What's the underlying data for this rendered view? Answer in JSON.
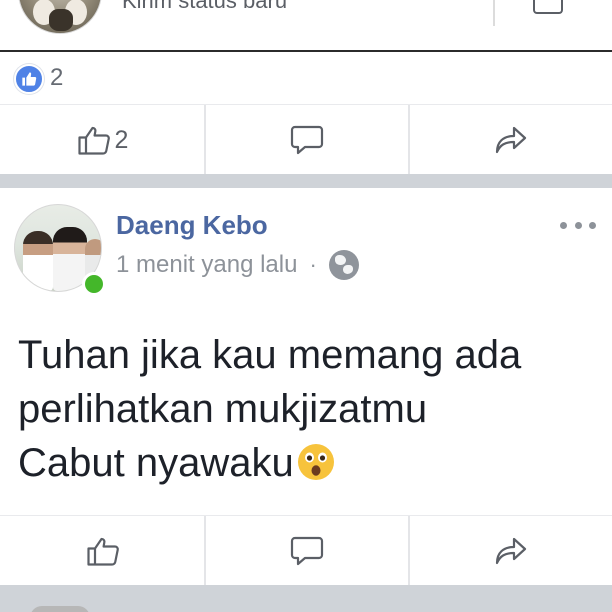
{
  "top_composer": {
    "status_prompt": "Kirim status baru"
  },
  "previous_post": {
    "reaction_count": "2",
    "like_count": "2"
  },
  "post": {
    "author": "Daeng Kebo",
    "time": "1 menit yang lalu",
    "separator": "·",
    "privacy_icon": "globe-icon",
    "online": true,
    "text_lines": [
      "Tuhan jika kau memang ada",
      "perlihatkan mukjizatmu",
      "Cabut nyawaku"
    ],
    "emoji": "astonished-face-icon"
  },
  "actions": {
    "like_icon": "thumbs-up-icon",
    "comment_icon": "comment-bubble-icon",
    "share_icon": "share-arrow-icon"
  },
  "colors": {
    "author_blue": "#4b67a1",
    "like_blue": "#4f82e6",
    "online_green": "#44b72a",
    "icon_gray": "#5b5f66",
    "meta_gray": "#8d9299",
    "separator_band": "#cfd3d8"
  }
}
